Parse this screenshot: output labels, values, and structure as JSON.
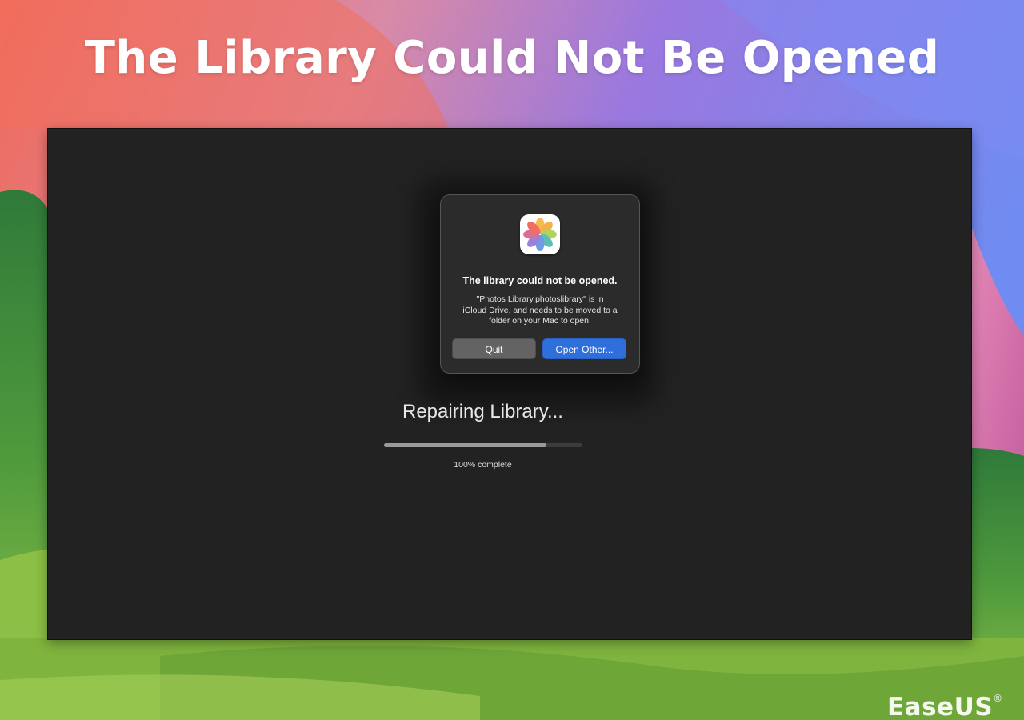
{
  "headline": "The Library Could Not Be Opened",
  "dialog": {
    "icon": "photos-app-icon",
    "title": "The library could not be opened.",
    "message_lines": [
      "\"Photos Library.photoslibrary\" is in",
      "iCloud Drive, and needs to be moved to a",
      "folder on your Mac to open."
    ],
    "quit_label": "Quit",
    "open_other_label": "Open Other..."
  },
  "repair": {
    "title": "Repairing Library...",
    "progress_fraction": 0.82,
    "progress_label": "100% complete"
  },
  "watermark": {
    "brand": "EaseUS",
    "registered_mark": "®"
  },
  "colors": {
    "window_bg": "#222222",
    "dialog_bg": "#2b2b2b",
    "primary_button": "#2f6fdb",
    "secondary_button": "#636363"
  }
}
